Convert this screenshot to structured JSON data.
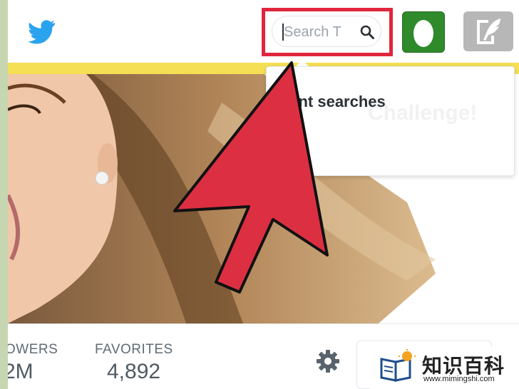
{
  "header": {
    "logo_icon": "twitter-bird-icon",
    "search": {
      "placeholder": "Search T",
      "icon": "search-icon"
    },
    "avatar_icon": "egg-avatar-icon",
    "compose_icon": "quill-compose-icon"
  },
  "dropdown": {
    "title": "cent searches",
    "background_word": "Challenge!"
  },
  "profile_stats": [
    {
      "label": "OWERS",
      "value": "2M"
    },
    {
      "label": "FAVORITES",
      "value": "4,892"
    }
  ],
  "settings_icon": "gear-icon",
  "watermark": {
    "title": "知识百科",
    "url": "www.mimingshi.com",
    "icon": "book-lightbulb-icon"
  },
  "colors": {
    "highlight_red": "#e0263d",
    "twitter_blue": "#1da1f2",
    "egg_green": "#2f8a2b",
    "frame_green": "#c5d6b1",
    "strip_yellow": "#f4df55"
  }
}
